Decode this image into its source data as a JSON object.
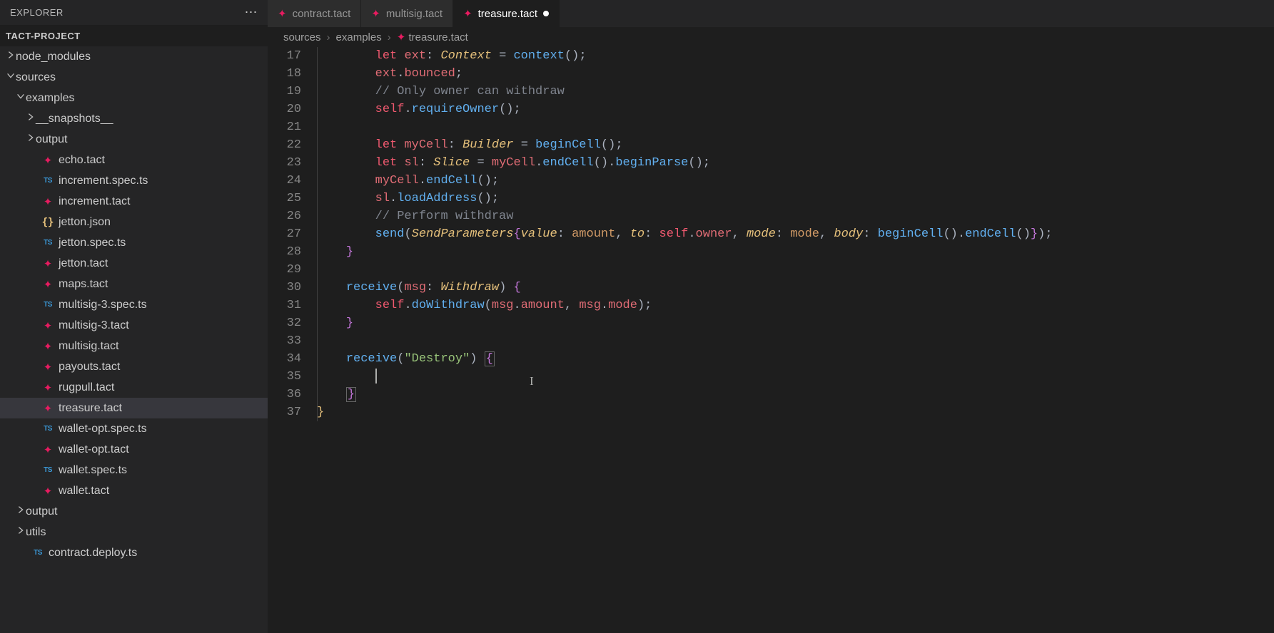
{
  "sidebar": {
    "title": "EXPLORER",
    "project_name": "TACT-PROJECT",
    "tree": [
      {
        "label": "node_modules",
        "kind": "folder",
        "expanded": false,
        "depth": 0
      },
      {
        "label": "sources",
        "kind": "folder",
        "expanded": true,
        "depth": 0
      },
      {
        "label": "examples",
        "kind": "folder",
        "expanded": true,
        "depth": 1
      },
      {
        "label": "__snapshots__",
        "kind": "folder",
        "expanded": false,
        "depth": 2
      },
      {
        "label": "output",
        "kind": "folder",
        "expanded": false,
        "depth": 2
      },
      {
        "label": "echo.tact",
        "kind": "tact",
        "depth": 2
      },
      {
        "label": "increment.spec.ts",
        "kind": "ts",
        "depth": 2
      },
      {
        "label": "increment.tact",
        "kind": "tact",
        "depth": 2
      },
      {
        "label": "jetton.json",
        "kind": "json",
        "depth": 2
      },
      {
        "label": "jetton.spec.ts",
        "kind": "ts",
        "depth": 2
      },
      {
        "label": "jetton.tact",
        "kind": "tact",
        "depth": 2
      },
      {
        "label": "maps.tact",
        "kind": "tact",
        "depth": 2
      },
      {
        "label": "multisig-3.spec.ts",
        "kind": "ts",
        "depth": 2
      },
      {
        "label": "multisig-3.tact",
        "kind": "tact",
        "depth": 2
      },
      {
        "label": "multisig.tact",
        "kind": "tact",
        "depth": 2
      },
      {
        "label": "payouts.tact",
        "kind": "tact",
        "depth": 2
      },
      {
        "label": "rugpull.tact",
        "kind": "tact",
        "depth": 2
      },
      {
        "label": "treasure.tact",
        "kind": "tact",
        "depth": 2,
        "active": true
      },
      {
        "label": "wallet-opt.spec.ts",
        "kind": "ts",
        "depth": 2
      },
      {
        "label": "wallet-opt.tact",
        "kind": "tact",
        "depth": 2
      },
      {
        "label": "wallet.spec.ts",
        "kind": "ts",
        "depth": 2
      },
      {
        "label": "wallet.tact",
        "kind": "tact",
        "depth": 2
      },
      {
        "label": "output",
        "kind": "folder",
        "expanded": false,
        "depth": 1
      },
      {
        "label": "utils",
        "kind": "folder",
        "expanded": false,
        "depth": 1
      },
      {
        "label": "contract.deploy.ts",
        "kind": "ts",
        "depth": 1
      }
    ]
  },
  "tabs": [
    {
      "label": "contract.tact",
      "kind": "tact",
      "active": false,
      "dirty": false
    },
    {
      "label": "multisig.tact",
      "kind": "tact",
      "active": false,
      "dirty": false
    },
    {
      "label": "treasure.tact",
      "kind": "tact",
      "active": true,
      "dirty": true
    }
  ],
  "breadcrumbs": [
    {
      "label": "sources"
    },
    {
      "label": "examples"
    },
    {
      "label": "treasure.tact",
      "icon": "tact"
    }
  ],
  "code": {
    "first_line_number": 17,
    "lines": [
      {
        "tokens": [
          [
            "        ",
            ""
          ],
          [
            "let",
            "kw"
          ],
          [
            " ",
            ""
          ],
          [
            "ext",
            "var"
          ],
          [
            ":",
            ""
          ],
          [
            " ",
            ""
          ],
          [
            "Context",
            "type"
          ],
          [
            " ",
            ""
          ],
          [
            "=",
            ""
          ],
          [
            " ",
            ""
          ],
          [
            "context",
            "func"
          ],
          [
            "(",
            ""
          ],
          [
            ")",
            ""
          ],
          [
            ";",
            ""
          ]
        ]
      },
      {
        "tokens": [
          [
            "        ",
            ""
          ],
          [
            "ext",
            "var"
          ],
          [
            ".",
            ""
          ],
          [
            "bounced",
            "prop"
          ],
          [
            ";",
            ""
          ]
        ]
      },
      {
        "tokens": [
          [
            "        ",
            ""
          ],
          [
            "// Only owner can withdraw",
            "comment"
          ]
        ]
      },
      {
        "tokens": [
          [
            "        ",
            ""
          ],
          [
            "self",
            "kw"
          ],
          [
            ".",
            ""
          ],
          [
            "requireOwner",
            "func"
          ],
          [
            "(",
            ""
          ],
          [
            ")",
            ""
          ],
          [
            ";",
            ""
          ]
        ]
      },
      {
        "tokens": [
          [
            "",
            ""
          ]
        ]
      },
      {
        "tokens": [
          [
            "        ",
            ""
          ],
          [
            "let",
            "kw"
          ],
          [
            " ",
            ""
          ],
          [
            "myCell",
            "var"
          ],
          [
            ":",
            ""
          ],
          [
            " ",
            ""
          ],
          [
            "Builder",
            "type"
          ],
          [
            " ",
            ""
          ],
          [
            "=",
            ""
          ],
          [
            " ",
            ""
          ],
          [
            "beginCell",
            "func"
          ],
          [
            "(",
            ""
          ],
          [
            ")",
            ""
          ],
          [
            ";",
            ""
          ]
        ]
      },
      {
        "tokens": [
          [
            "        ",
            ""
          ],
          [
            "let",
            "kw"
          ],
          [
            " ",
            ""
          ],
          [
            "sl",
            "var"
          ],
          [
            ":",
            ""
          ],
          [
            " ",
            ""
          ],
          [
            "Slice",
            "type"
          ],
          [
            " ",
            ""
          ],
          [
            "=",
            ""
          ],
          [
            " ",
            ""
          ],
          [
            "myCell",
            "var"
          ],
          [
            ".",
            ""
          ],
          [
            "endCell",
            "func"
          ],
          [
            "(",
            ""
          ],
          [
            ")",
            ""
          ],
          [
            ".",
            ""
          ],
          [
            "beginParse",
            "func"
          ],
          [
            "(",
            ""
          ],
          [
            ")",
            ""
          ],
          [
            ";",
            ""
          ]
        ]
      },
      {
        "tokens": [
          [
            "        ",
            ""
          ],
          [
            "myCell",
            "var"
          ],
          [
            ".",
            ""
          ],
          [
            "endCell",
            "func"
          ],
          [
            "(",
            ""
          ],
          [
            ")",
            ""
          ],
          [
            ";",
            ""
          ]
        ]
      },
      {
        "tokens": [
          [
            "        ",
            ""
          ],
          [
            "sl",
            "var"
          ],
          [
            ".",
            ""
          ],
          [
            "loadAddress",
            "func"
          ],
          [
            "(",
            ""
          ],
          [
            ")",
            ""
          ],
          [
            ";",
            ""
          ]
        ]
      },
      {
        "tokens": [
          [
            "        ",
            ""
          ],
          [
            "// Perform withdraw",
            "comment"
          ]
        ]
      },
      {
        "tokens": [
          [
            "        ",
            ""
          ],
          [
            "send",
            "func"
          ],
          [
            "(",
            ""
          ],
          [
            "SendParameters",
            "type2"
          ],
          [
            "{",
            "curly"
          ],
          [
            "value",
            "param"
          ],
          [
            ":",
            ""
          ],
          [
            " ",
            ""
          ],
          [
            "amount",
            "amt"
          ],
          [
            ",",
            ""
          ],
          [
            " ",
            ""
          ],
          [
            "to",
            "param"
          ],
          [
            ":",
            ""
          ],
          [
            " ",
            ""
          ],
          [
            "self",
            "kw"
          ],
          [
            ".",
            ""
          ],
          [
            "owner",
            "prop"
          ],
          [
            ",",
            ""
          ],
          [
            " ",
            ""
          ],
          [
            "mode",
            "param"
          ],
          [
            ":",
            ""
          ],
          [
            " ",
            ""
          ],
          [
            "mode",
            "amt"
          ],
          [
            ",",
            ""
          ],
          [
            " ",
            ""
          ],
          [
            "body",
            "param"
          ],
          [
            ":",
            ""
          ],
          [
            " ",
            ""
          ],
          [
            "beginCell",
            "func"
          ],
          [
            "(",
            ""
          ],
          [
            ")",
            ""
          ],
          [
            ".",
            ""
          ],
          [
            "endCell",
            "func"
          ],
          [
            "(",
            ""
          ],
          [
            ")",
            ""
          ],
          [
            "}",
            "curly"
          ],
          [
            ")",
            ""
          ],
          [
            ";",
            ""
          ]
        ]
      },
      {
        "tokens": [
          [
            "    ",
            ""
          ],
          [
            "}",
            "curly"
          ]
        ]
      },
      {
        "tokens": [
          [
            "",
            ""
          ]
        ]
      },
      {
        "tokens": [
          [
            "    ",
            ""
          ],
          [
            "receive",
            "func"
          ],
          [
            "(",
            ""
          ],
          [
            "msg",
            "var"
          ],
          [
            ":",
            ""
          ],
          [
            " ",
            ""
          ],
          [
            "Withdraw",
            "type"
          ],
          [
            ")",
            ""
          ],
          [
            " ",
            ""
          ],
          [
            "{",
            "curly"
          ]
        ]
      },
      {
        "tokens": [
          [
            "        ",
            ""
          ],
          [
            "self",
            "kw"
          ],
          [
            ".",
            ""
          ],
          [
            "doWithdraw",
            "func"
          ],
          [
            "(",
            ""
          ],
          [
            "msg",
            "var"
          ],
          [
            ".",
            ""
          ],
          [
            "amount",
            "prop"
          ],
          [
            ",",
            ""
          ],
          [
            " ",
            ""
          ],
          [
            "msg",
            "var"
          ],
          [
            ".",
            ""
          ],
          [
            "mode",
            "prop"
          ],
          [
            ")",
            ""
          ],
          [
            ";",
            ""
          ]
        ]
      },
      {
        "tokens": [
          [
            "    ",
            ""
          ],
          [
            "}",
            "curly"
          ]
        ]
      },
      {
        "tokens": [
          [
            "",
            ""
          ]
        ]
      },
      {
        "tokens": [
          [
            "    ",
            ""
          ],
          [
            "receive",
            "func"
          ],
          [
            "(",
            ""
          ],
          [
            "\"Destroy\"",
            "str"
          ],
          [
            ")",
            ""
          ],
          [
            " ",
            ""
          ],
          [
            "{",
            "curly-box"
          ]
        ]
      },
      {
        "tokens": [
          [
            "        ",
            ""
          ],
          [
            "",
            "caret"
          ]
        ]
      },
      {
        "tokens": [
          [
            "    ",
            ""
          ],
          [
            "}",
            "curly-box"
          ]
        ]
      },
      {
        "tokens": [
          [
            "}",
            "curly-y"
          ]
        ]
      }
    ]
  },
  "colors": {
    "accent": "#e81b60"
  }
}
